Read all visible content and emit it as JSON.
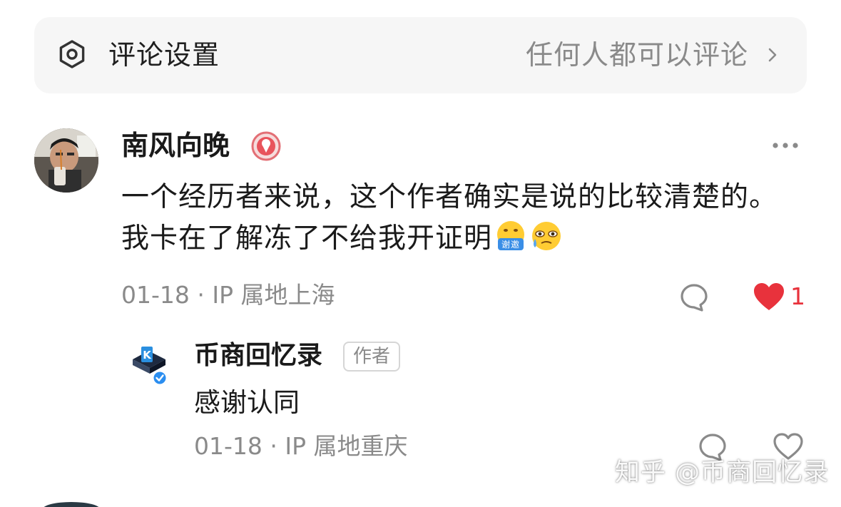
{
  "settings": {
    "label": "评论设置",
    "value": "任何人都可以评论",
    "icon": "settings-hexagon-icon"
  },
  "comment": {
    "author": "南风向晚",
    "author_badge_icon": "ice-cream-badge-icon",
    "text": "一个经历者来说，这个作者确实是说的比较清楚的。我卡在了解冻了不给我开证明",
    "emojis": [
      "thank-you-emoji",
      "teary-emoji"
    ],
    "date": "01-18",
    "location": "IP 属地上海",
    "like_count": "1",
    "liked": true,
    "like_color": "#e8323c"
  },
  "reply": {
    "author": "币商回忆录",
    "tag": "作者",
    "text": "感谢认同",
    "date": "01-18",
    "location": "IP 属地重庆",
    "verified_color": "#2b8ef0"
  },
  "emoji_label": "谢邀",
  "separator": " · ",
  "watermark": "知乎 @币商回忆录"
}
